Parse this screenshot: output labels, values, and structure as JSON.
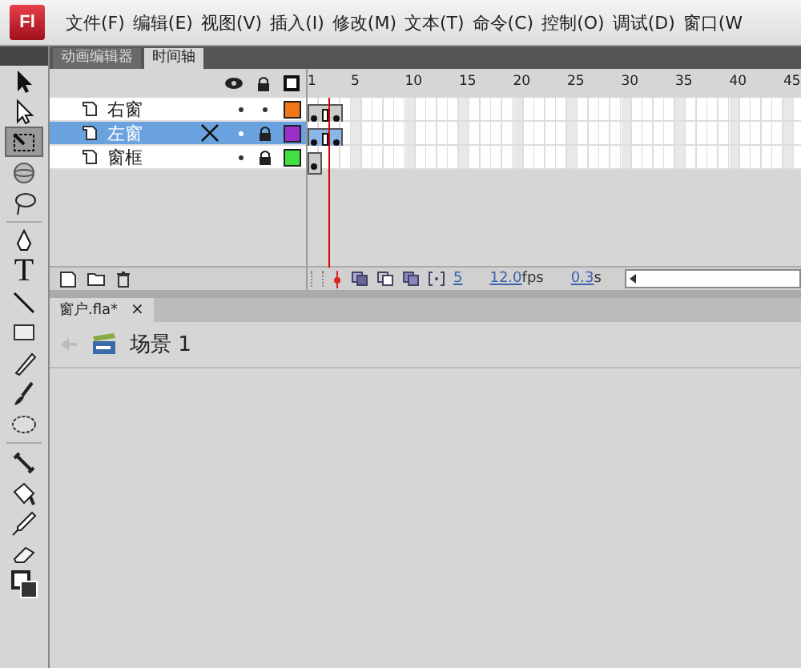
{
  "app": {
    "logo": "Fl"
  },
  "menu": [
    "文件(F)",
    "编辑(E)",
    "视图(V)",
    "插入(I)",
    "修改(M)",
    "文本(T)",
    "命令(C)",
    "控制(O)",
    "调试(D)",
    "窗口(W"
  ],
  "panel_tabs": [
    {
      "label": "动画编辑器",
      "selected": false
    },
    {
      "label": "时间轴",
      "selected": true
    }
  ],
  "toolbar": {
    "groups": [
      [
        {
          "kind": "arrow",
          "selected": false
        },
        {
          "kind": "subselect",
          "selected": false
        },
        {
          "kind": "transform",
          "selected": true
        },
        {
          "kind": "sphere",
          "selected": false
        },
        {
          "kind": "lasso",
          "selected": false
        }
      ],
      [
        {
          "kind": "pen",
          "selected": false
        },
        {
          "kind": "text",
          "selected": false,
          "glyph": "T"
        },
        {
          "kind": "line",
          "selected": false
        },
        {
          "kind": "rect",
          "selected": false
        },
        {
          "kind": "pencil",
          "selected": false
        },
        {
          "kind": "brush",
          "selected": false
        },
        {
          "kind": "deco",
          "selected": false
        }
      ],
      [
        {
          "kind": "bone",
          "selected": false
        },
        {
          "kind": "bucket",
          "selected": false
        },
        {
          "kind": "dropper",
          "selected": false
        },
        {
          "kind": "eraser",
          "selected": false
        },
        {
          "kind": "colors",
          "selected": false
        }
      ]
    ]
  },
  "timeline": {
    "ruler": [
      "1",
      "5",
      "10",
      "15",
      "20",
      "25",
      "30",
      "35",
      "40",
      "45"
    ],
    "layers": [
      {
        "name": "右窗",
        "selected": false,
        "locked": false,
        "color": "#f07818",
        "frames": [
          {
            "kind": "keyframe"
          },
          {
            "kind": "end"
          },
          {
            "kind": "keyframe"
          }
        ]
      },
      {
        "name": "左窗",
        "selected": true,
        "locked": true,
        "color": "#9a30c8",
        "frames": [
          {
            "kind": "keyframe"
          },
          {
            "kind": "end"
          },
          {
            "kind": "keyframe"
          }
        ]
      },
      {
        "name": "窗框",
        "selected": false,
        "locked": true,
        "color": "#40e040",
        "frames": [
          {
            "kind": "keyframe"
          }
        ]
      }
    ],
    "current_frame": "5",
    "fps": "12.0",
    "fps_unit": "fps",
    "time": "0.3",
    "time_unit": "s"
  },
  "document": {
    "tab": "窗户.fla*",
    "close": "×",
    "scene": "场景 1"
  }
}
